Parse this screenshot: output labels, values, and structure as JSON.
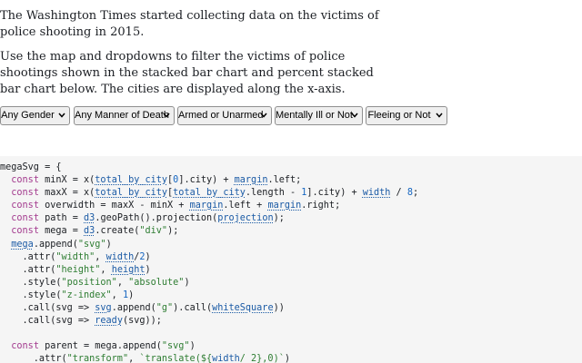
{
  "intro": {
    "paragraph1": "The Washington Times started collecting data on the victims of police shooting in 2015.",
    "paragraph2": "Use the map and dropdowns to filter the victims of police shootings shown in the stacked bar chart and percent stacked bar chart below. The cities are displayed along the x-axis."
  },
  "filters": [
    {
      "id": "gender",
      "value": "Any Gender"
    },
    {
      "id": "manner",
      "value": "Any Manner of Death"
    },
    {
      "id": "armed",
      "value": "Armed or Unarmed"
    },
    {
      "id": "mental",
      "value": "Mentally Ill or Not"
    },
    {
      "id": "fleeing",
      "value": "Fleeing or Not"
    }
  ],
  "code": {
    "lines": [
      [
        [
          "t",
          "megaSvg = {"
        ]
      ],
      [
        [
          "t",
          "  "
        ],
        [
          "k",
          "const"
        ],
        [
          "t",
          " minX = x("
        ],
        [
          "r",
          "total_by_city"
        ],
        [
          "t",
          "["
        ],
        [
          "n",
          "0"
        ],
        [
          "t",
          "].city) + "
        ],
        [
          "r",
          "margin"
        ],
        [
          "t",
          ".left;"
        ]
      ],
      [
        [
          "t",
          "  "
        ],
        [
          "k",
          "const"
        ],
        [
          "t",
          " maxX = x("
        ],
        [
          "r",
          "total_by_city"
        ],
        [
          "t",
          "["
        ],
        [
          "r",
          "total_by_city"
        ],
        [
          "t",
          ".length - "
        ],
        [
          "n",
          "1"
        ],
        [
          "t",
          "].city) + "
        ],
        [
          "r",
          "width"
        ],
        [
          "t",
          " / "
        ],
        [
          "n",
          "8"
        ],
        [
          "t",
          ";"
        ]
      ],
      [
        [
          "t",
          "  "
        ],
        [
          "k",
          "const"
        ],
        [
          "t",
          " overwidth = maxX - minX + "
        ],
        [
          "r",
          "margin"
        ],
        [
          "t",
          ".left + "
        ],
        [
          "r",
          "margin"
        ],
        [
          "t",
          ".right;"
        ]
      ],
      [
        [
          "t",
          "  "
        ],
        [
          "k",
          "const"
        ],
        [
          "t",
          " path = "
        ],
        [
          "r",
          "d3"
        ],
        [
          "t",
          ".geoPath().projection("
        ],
        [
          "r",
          "projection"
        ],
        [
          "t",
          ");"
        ]
      ],
      [
        [
          "t",
          "  "
        ],
        [
          "k",
          "const"
        ],
        [
          "t",
          " mega = "
        ],
        [
          "r",
          "d3"
        ],
        [
          "t",
          ".create("
        ],
        [
          "s",
          "\"div\""
        ],
        [
          "t",
          ");"
        ]
      ],
      [
        [
          "t",
          "  "
        ],
        [
          "r",
          "mega"
        ],
        [
          "t",
          ".append("
        ],
        [
          "s",
          "\"svg\""
        ],
        [
          "t",
          ")"
        ]
      ],
      [
        [
          "t",
          "    .attr("
        ],
        [
          "s",
          "\"width\""
        ],
        [
          "t",
          ", "
        ],
        [
          "r",
          "width"
        ],
        [
          "t",
          "/"
        ],
        [
          "n",
          "2"
        ],
        [
          "t",
          ")"
        ]
      ],
      [
        [
          "t",
          "    .attr("
        ],
        [
          "s",
          "\"height\""
        ],
        [
          "t",
          ", "
        ],
        [
          "r",
          "height"
        ],
        [
          "t",
          ")"
        ]
      ],
      [
        [
          "t",
          "    .style("
        ],
        [
          "s",
          "\"position\""
        ],
        [
          "t",
          ", "
        ],
        [
          "s",
          "\"absolute\""
        ],
        [
          "t",
          ")"
        ]
      ],
      [
        [
          "t",
          "    .style("
        ],
        [
          "s",
          "\"z-index\""
        ],
        [
          "t",
          ", "
        ],
        [
          "n",
          "1"
        ],
        [
          "t",
          ")"
        ]
      ],
      [
        [
          "t",
          "    .call(svg => "
        ],
        [
          "r",
          "svg"
        ],
        [
          "t",
          ".append("
        ],
        [
          "s",
          "\"g\""
        ],
        [
          "t",
          ").call("
        ],
        [
          "r",
          "whiteSquare"
        ],
        [
          "t",
          "))"
        ]
      ],
      [
        [
          "t",
          "    .call(svg => "
        ],
        [
          "r",
          "ready"
        ],
        [
          "t",
          "(svg));"
        ]
      ],
      [
        [
          "t",
          ""
        ]
      ],
      [
        [
          "t",
          "  "
        ],
        [
          "k",
          "const"
        ],
        [
          "t",
          " parent = mega.append("
        ],
        [
          "s",
          "\"svg\""
        ],
        [
          "t",
          ")"
        ]
      ],
      [
        [
          "t",
          "      .attr("
        ],
        [
          "s",
          "\"transform\""
        ],
        [
          "t",
          ", "
        ],
        [
          "s",
          "`translate(${"
        ],
        [
          "r",
          "width"
        ],
        [
          "s",
          "/ 2},0)`"
        ],
        [
          "t",
          ")"
        ]
      ]
    ]
  }
}
